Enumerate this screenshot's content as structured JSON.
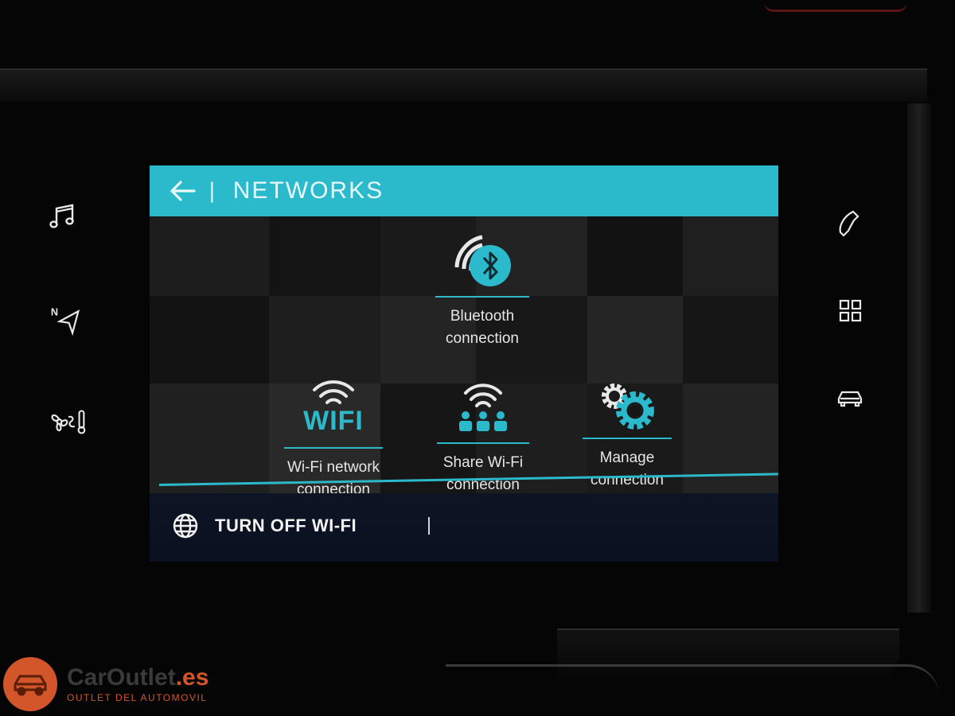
{
  "colors": {
    "accent": "#2bb9cc",
    "header_text": "#e9f8fb",
    "logo": "#d2562a"
  },
  "side_left": [
    {
      "icon": "music-note-icon"
    },
    {
      "icon": "navigation-icon",
      "label": "N"
    },
    {
      "icon": "climate-icon"
    }
  ],
  "side_right": [
    {
      "icon": "phone-icon"
    },
    {
      "icon": "apps-grid-icon"
    },
    {
      "icon": "car-icon"
    }
  ],
  "header": {
    "back_icon": "back-arrow-icon",
    "separator": "|",
    "title": "NETWORKS"
  },
  "tiles": {
    "bluetooth": {
      "icon": "bluetooth-icon",
      "label": "Bluetooth\nconnection"
    },
    "wifi": {
      "icon": "wifi-icon",
      "icon_text": "WIFI",
      "label": "Wi-Fi network\nconnection"
    },
    "share_wifi": {
      "icon": "share-wifi-icon",
      "label": "Share Wi-Fi\nconnection"
    },
    "manage": {
      "icon": "gears-icon",
      "label": "Manage\nconnection"
    }
  },
  "bottom_bar": {
    "icon": "globe-icon",
    "turn_off_label": "TURN OFF WI-FI"
  },
  "watermark": {
    "brand": "CarOutlet",
    "tld": ".es",
    "tagline": "OUTLET DEL AUTOMOVIL"
  }
}
